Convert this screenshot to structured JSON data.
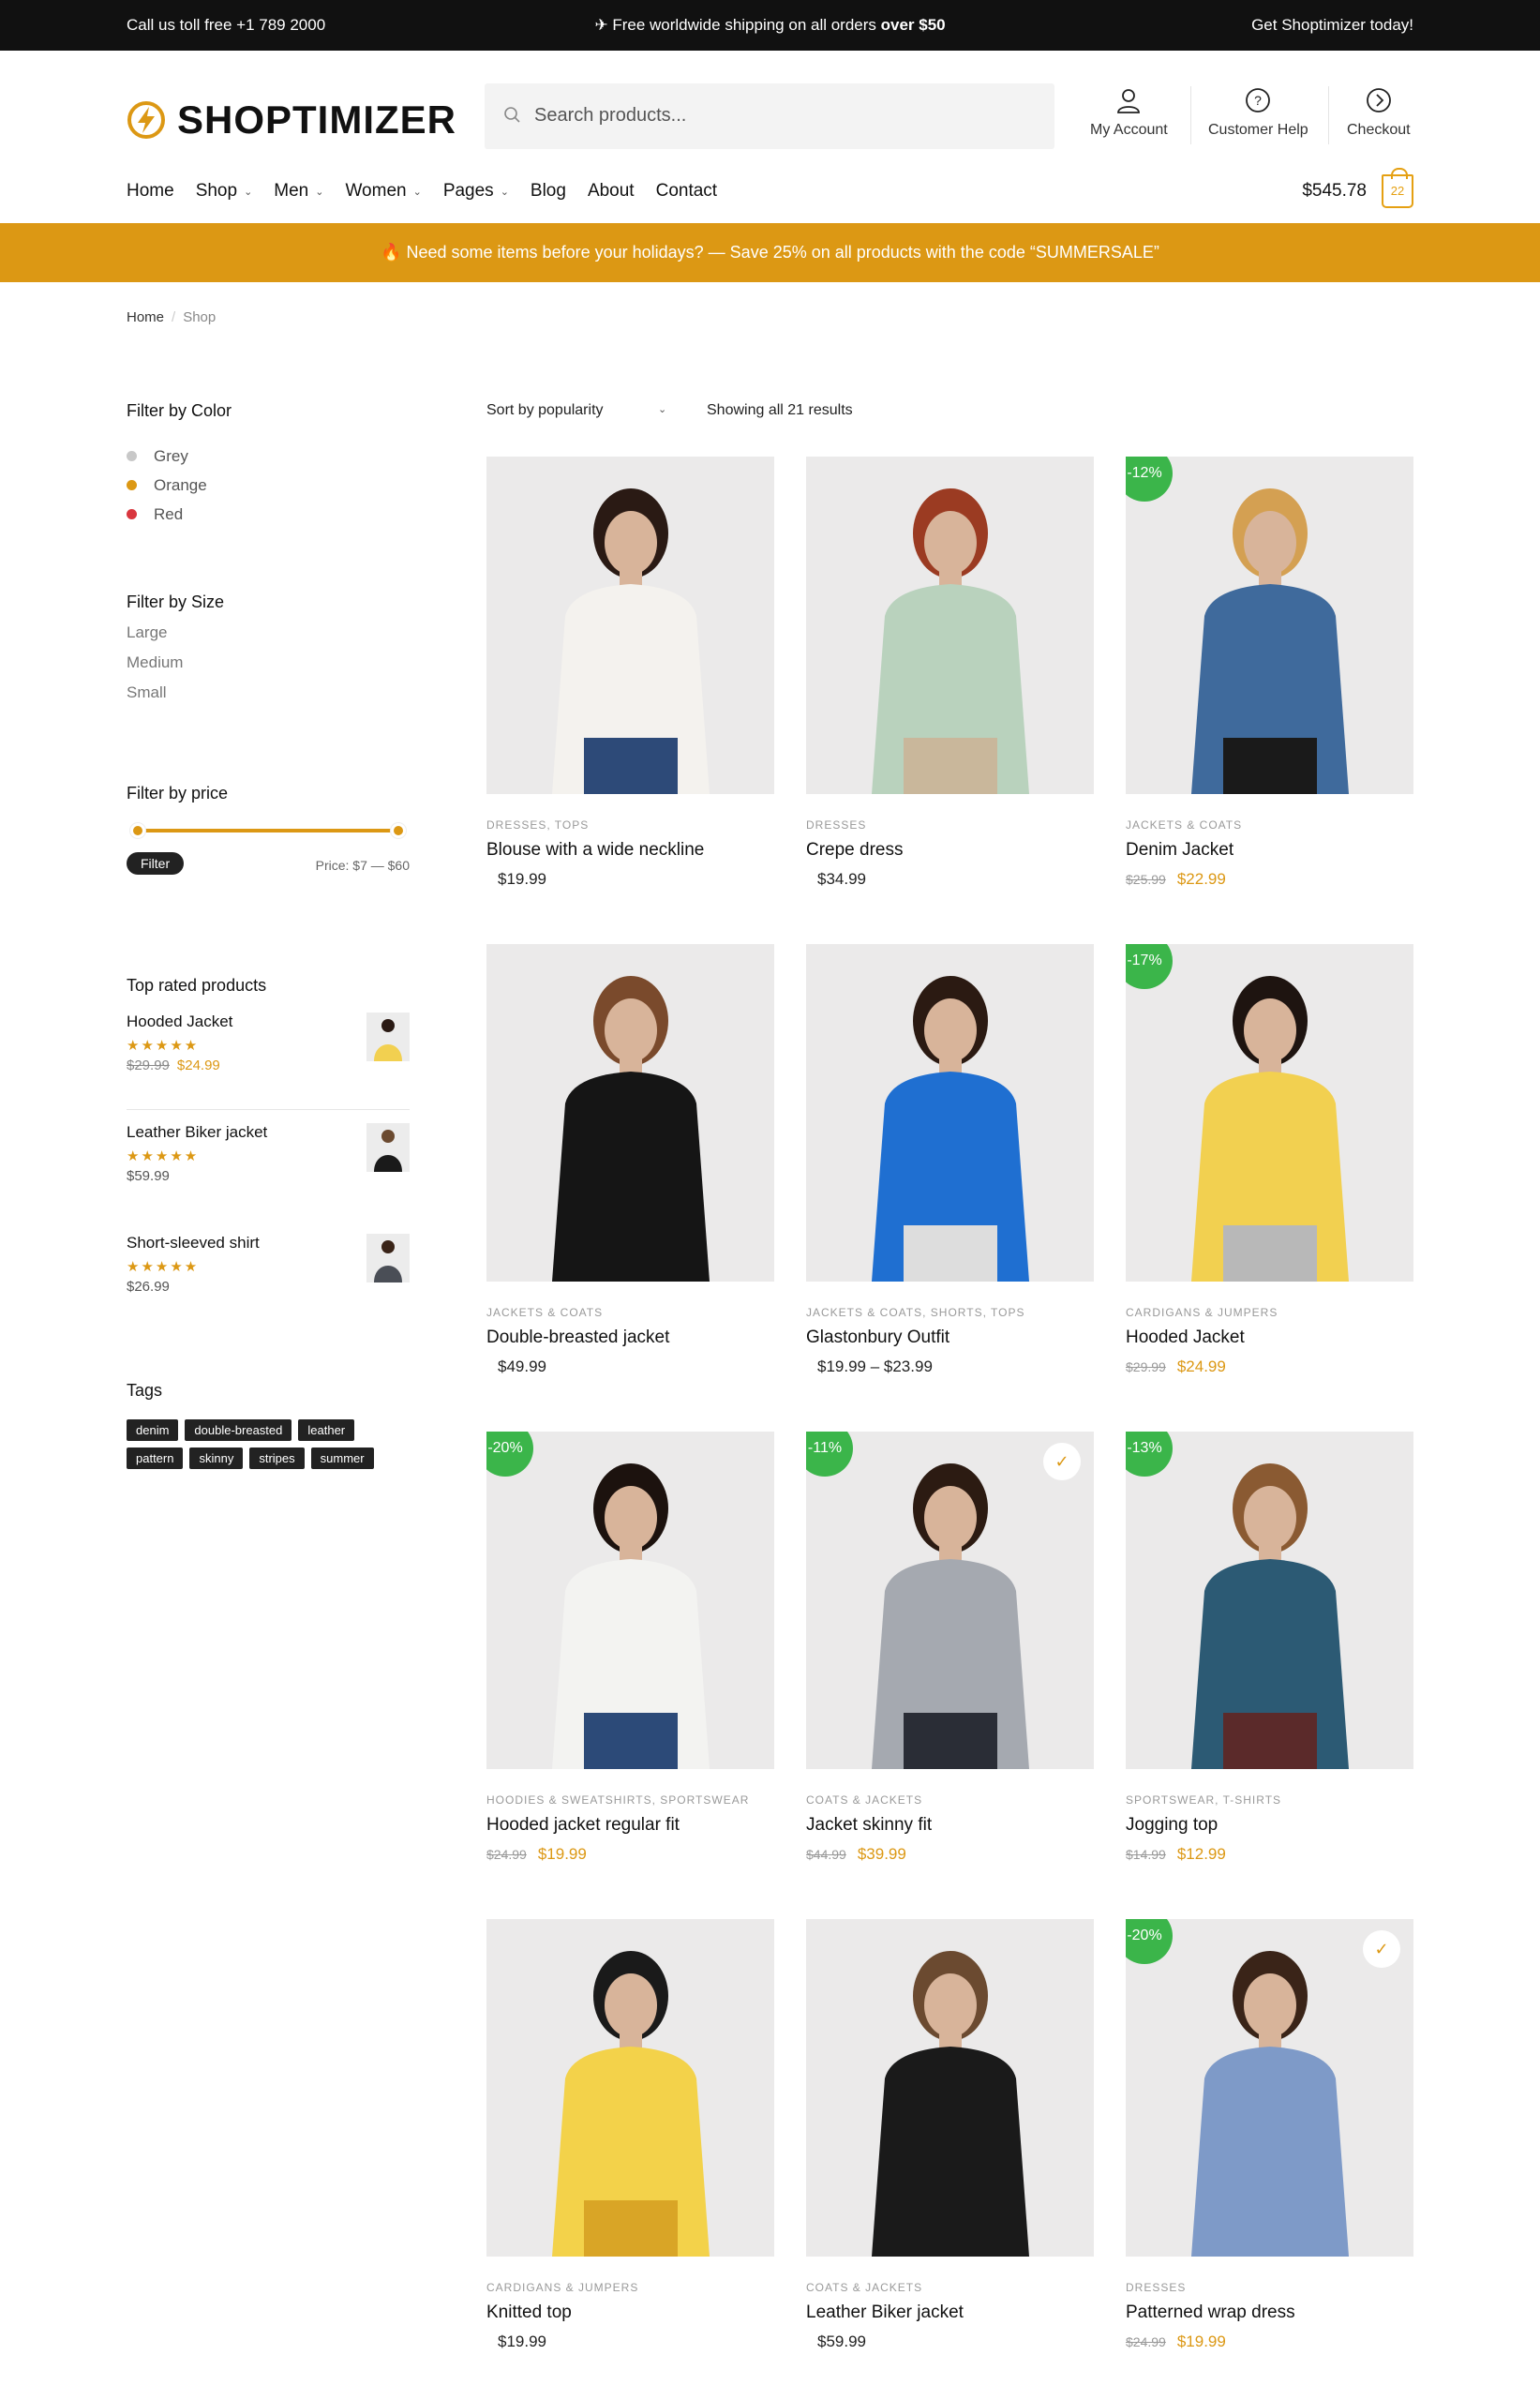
{
  "topbar": {
    "left": "Call us toll free +1 789 2000",
    "center_prefix": "✈ Free worldwide shipping on all orders ",
    "center_bold": "over $50",
    "right": "Get Shoptimizer today!"
  },
  "header": {
    "logo_text": "SHOPTIMIZER",
    "search_placeholder": "Search products...",
    "account_label": "My Account",
    "help_label": "Customer Help",
    "checkout_label": "Checkout",
    "cart_total": "$545.78",
    "cart_count": "22"
  },
  "nav": {
    "items": [
      "Home",
      "Shop",
      "Men",
      "Women",
      "Pages",
      "Blog",
      "About",
      "Contact"
    ]
  },
  "promo": "🔥 Need some items before your holidays? — Save 25% on all products with the code “SUMMERSALE”",
  "breadcrumb": {
    "home": "Home",
    "current": "Shop"
  },
  "sidebar": {
    "color_title": "Filter by Color",
    "colors": [
      {
        "label": "Grey",
        "color": "#c8c8c8"
      },
      {
        "label": "Orange",
        "color": "#dc9814"
      },
      {
        "label": "Red",
        "color": "#d9363e"
      }
    ],
    "size_title": "Filter by Size",
    "sizes": [
      "Large",
      "Medium",
      "Small"
    ],
    "price_title": "Filter by price",
    "filter_button": "Filter",
    "price_range": "Price: $7 — $60",
    "top_rated_title": "Top rated products",
    "top_rated": [
      {
        "name": "Hooded Jacket",
        "stars": "★★★★★",
        "old": "$29.99",
        "price": "$24.99"
      },
      {
        "name": "Leather Biker jacket",
        "stars": "★★★★★",
        "old": "",
        "price": "$59.99"
      },
      {
        "name": "Short-sleeved shirt",
        "stars": "★★★★★",
        "old": "",
        "price": "$26.99"
      }
    ],
    "tags_title": "Tags",
    "tags": [
      "denim",
      "double-breasted",
      "leather",
      "pattern",
      "skinny",
      "stripes",
      "summer"
    ]
  },
  "toolbar": {
    "sort": "Sort by popularity",
    "showing": "Showing all 21 results"
  },
  "products": [
    {
      "cat": "Dresses, Tops",
      "name": "Blouse with a wide neckline",
      "old": "",
      "price": "$19.99",
      "badge": "",
      "check": false,
      "colors": [
        "#f4f2ee",
        "#2d4a78",
        "#2a1a14"
      ]
    },
    {
      "cat": "Dresses",
      "name": "Crepe dress",
      "old": "",
      "price": "$34.99",
      "badge": "",
      "check": false,
      "colors": [
        "#b9d2bd",
        "#c9b79b",
        "#9b3b22"
      ]
    },
    {
      "cat": "Jackets & Coats",
      "name": "Denim Jacket",
      "old": "$25.99",
      "price": "$22.99",
      "badge": "-12%",
      "check": false,
      "colors": [
        "#3f6a9c",
        "#1a1a1a",
        "#d4a052"
      ]
    },
    {
      "cat": "Jackets & Coats",
      "name": "Double-breasted jacket",
      "old": "",
      "price": "$49.99",
      "badge": "",
      "check": false,
      "colors": [
        "#151515",
        "#151515",
        "#7a4a2c"
      ]
    },
    {
      "cat": "Jackets & Coats, Shorts, Tops",
      "name": "Glastonbury Outfit",
      "old": "",
      "price": "$19.99 – $23.99",
      "badge": "",
      "check": false,
      "colors": [
        "#1f6fd1",
        "#ddd",
        "#2b1a12"
      ]
    },
    {
      "cat": "Cardigans & Jumpers",
      "name": "Hooded Jacket",
      "old": "$29.99",
      "price": "$24.99",
      "badge": "-17%",
      "check": false,
      "colors": [
        "#f2d050",
        "#b8b8b8",
        "#1e1410"
      ]
    },
    {
      "cat": "Hoodies & Sweatshirts, Sportswear",
      "name": "Hooded jacket regular fit",
      "old": "$24.99",
      "price": "$19.99",
      "badge": "-20%",
      "check": false,
      "colors": [
        "#f3f3f1",
        "#2c4a78",
        "#1c120e"
      ]
    },
    {
      "cat": "Coats & Jackets",
      "name": "Jacket skinny fit",
      "old": "$44.99",
      "price": "$39.99",
      "badge": "-11%",
      "check": true,
      "colors": [
        "#a5a9b0",
        "#2a2d36",
        "#2c1b12"
      ]
    },
    {
      "cat": "Sportswear, T-Shirts",
      "name": "Jogging top",
      "old": "$14.99",
      "price": "$12.99",
      "badge": "-13%",
      "check": false,
      "colors": [
        "#2c5a74",
        "#5b2a2a",
        "#8a5a32"
      ]
    },
    {
      "cat": "Cardigans & Jumpers",
      "name": "Knitted top",
      "old": "",
      "price": "$19.99",
      "badge": "",
      "check": false,
      "colors": [
        "#f3d24a",
        "#d9a526",
        "#1a1a1a"
      ]
    },
    {
      "cat": "Coats & Jackets",
      "name": "Leather Biker jacket",
      "old": "",
      "price": "$59.99",
      "badge": "",
      "check": false,
      "colors": [
        "#1a1a1a",
        "#1a1a1a",
        "#6b4a30"
      ]
    },
    {
      "cat": "Dresses",
      "name": "Patterned wrap dress",
      "old": "$24.99",
      "price": "$19.99",
      "badge": "-20%",
      "check": true,
      "colors": [
        "#7e9ac8",
        "#7e9ac8",
        "#3a2418"
      ]
    }
  ]
}
